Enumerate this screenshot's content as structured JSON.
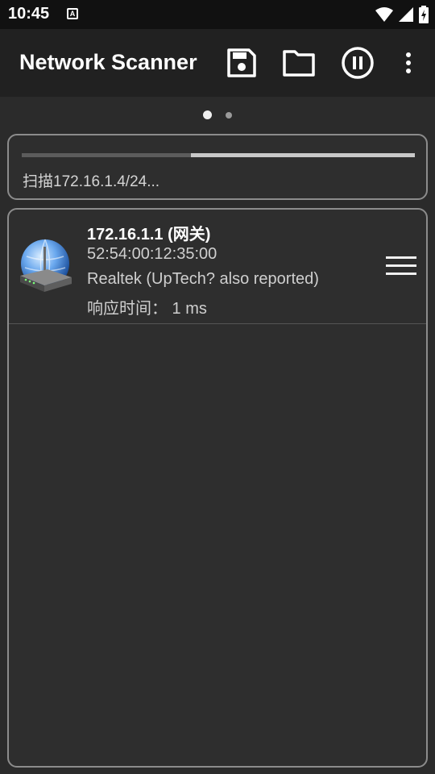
{
  "status_bar": {
    "time": "10:45",
    "notification_glyph": "A"
  },
  "app_bar": {
    "title": "Network Scanner",
    "actions": [
      "save-icon",
      "folder-icon",
      "pause-icon",
      "more-vert-icon"
    ]
  },
  "pager": {
    "pages": 2,
    "active_index": 0
  },
  "scan": {
    "status_text": "扫描172.16.1.4/24...",
    "progress": 0.43
  },
  "devices": [
    {
      "ip": "172.16.1.1 (网关)",
      "mac": "52:54:00:12:35:00",
      "vendor": "Realtek (UpTech? also reported)",
      "response": "响应时间：  1 ms",
      "icon": "router-globe-icon"
    }
  ],
  "colors": {
    "background": "#2b2b2b",
    "app_bar": "#212121",
    "status_bar": "#111111",
    "card_border": "#8c8c8c"
  }
}
